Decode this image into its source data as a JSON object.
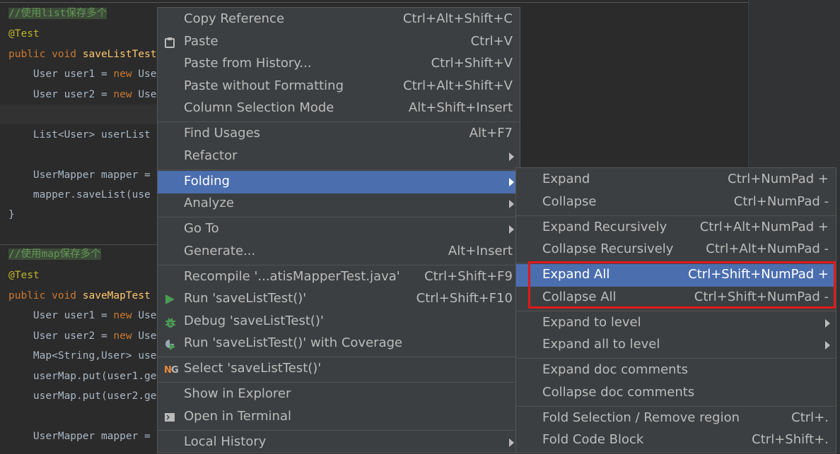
{
  "editor": {
    "lines": [
      {
        "parts": [
          {
            "t": "//使用list保存多个",
            "c": "cmt"
          }
        ]
      },
      {
        "parts": [
          {
            "t": "@Test",
            "c": "ann"
          }
        ]
      },
      {
        "parts": [
          {
            "t": "public void ",
            "c": "kw"
          },
          {
            "t": "saveListTest",
            "c": "fn"
          }
        ]
      },
      {
        "parts": [
          {
            "t": "    User user1 = ",
            "c": ""
          },
          {
            "t": "new ",
            "c": "kw"
          },
          {
            "t": "Use",
            "c": ""
          }
        ]
      },
      {
        "parts": [
          {
            "t": "    User user2 = ",
            "c": ""
          },
          {
            "t": "new ",
            "c": "kw"
          },
          {
            "t": "Use",
            "c": ""
          }
        ]
      },
      {
        "parts": []
      },
      {
        "parts": [
          {
            "t": "    List<User> userList",
            "c": ""
          }
        ]
      },
      {
        "parts": []
      },
      {
        "parts": [
          {
            "t": "    UserMapper mapper =",
            "c": ""
          }
        ]
      },
      {
        "parts": [
          {
            "t": "    mapper.saveList(use",
            "c": ""
          }
        ]
      },
      {
        "parts": [
          {
            "t": "}",
            "c": ""
          }
        ]
      },
      {
        "parts": []
      },
      {
        "parts": [
          {
            "t": "//使用map保存多个",
            "c": "cmt"
          }
        ]
      },
      {
        "parts": [
          {
            "t": "@Test",
            "c": "ann"
          }
        ]
      },
      {
        "parts": [
          {
            "t": "public void ",
            "c": "kw"
          },
          {
            "t": "saveMapTest",
            "c": "fn"
          }
        ]
      },
      {
        "parts": [
          {
            "t": "    User user1 = ",
            "c": ""
          },
          {
            "t": "new ",
            "c": "kw"
          },
          {
            "t": "Use",
            "c": ""
          }
        ]
      },
      {
        "parts": [
          {
            "t": "    User user2 = ",
            "c": ""
          },
          {
            "t": "new ",
            "c": "kw"
          },
          {
            "t": "Use",
            "c": ""
          }
        ]
      },
      {
        "parts": [
          {
            "t": "    Map<String,User> use",
            "c": ""
          }
        ]
      },
      {
        "parts": [
          {
            "t": "    userMap.put(user1.ge",
            "c": ""
          }
        ]
      },
      {
        "parts": [
          {
            "t": "    userMap.put(user2.ge",
            "c": ""
          }
        ]
      },
      {
        "parts": []
      },
      {
        "parts": [
          {
            "t": "    UserMapper mapper =",
            "c": ""
          }
        ]
      }
    ]
  },
  "context_menu": {
    "items": [
      {
        "label": "Copy Reference",
        "shortcut": "Ctrl+Alt+Shift+C"
      },
      {
        "label": "Paste",
        "shortcut": "Ctrl+V",
        "icon": "clipboard-icon"
      },
      {
        "label": "Paste from History...",
        "shortcut": "Ctrl+Shift+V"
      },
      {
        "label": "Paste without Formatting",
        "shortcut": "Ctrl+Alt+Shift+V"
      },
      {
        "label": "Column Selection Mode",
        "shortcut": "Alt+Shift+Insert"
      },
      {
        "label": "Find Usages",
        "shortcut": "Alt+F7"
      },
      {
        "label": "Refactor",
        "submenu": true
      },
      {
        "label": "Folding",
        "submenu": true,
        "selected": true
      },
      {
        "label": "Analyze",
        "submenu": true
      },
      {
        "label": "Go To",
        "submenu": true
      },
      {
        "label": "Generate...",
        "shortcut": "Alt+Insert"
      },
      {
        "label": "Recompile '...atisMapperTest.java'",
        "shortcut": "Ctrl+Shift+F9"
      },
      {
        "label": "Run 'saveListTest()'",
        "shortcut": "Ctrl+Shift+F10",
        "icon": "run-icon"
      },
      {
        "label": "Debug 'saveListTest()'",
        "icon": "debug-icon"
      },
      {
        "label": "Run 'saveListTest()' with Coverage",
        "icon": "coverage-icon"
      },
      {
        "label": "Select 'saveListTest()'",
        "icon": "testng-icon"
      },
      {
        "label": "Show in Explorer"
      },
      {
        "label": "Open in Terminal",
        "icon": "terminal-icon"
      },
      {
        "label": "Local History",
        "submenu": true
      }
    ]
  },
  "folding_submenu": {
    "items": [
      {
        "label": "Expand",
        "shortcut": "Ctrl+NumPad +"
      },
      {
        "label": "Collapse",
        "shortcut": "Ctrl+NumPad -"
      },
      {
        "label": "Expand Recursively",
        "shortcut": "Ctrl+Alt+NumPad +"
      },
      {
        "label": "Collapse Recursively",
        "shortcut": "Ctrl+Alt+NumPad -"
      },
      {
        "label": "Expand All",
        "shortcut": "Ctrl+Shift+NumPad +",
        "selected": true
      },
      {
        "label": "Collapse All",
        "shortcut": "Ctrl+Shift+NumPad -"
      },
      {
        "label": "Expand to level",
        "submenu": true
      },
      {
        "label": "Expand all to level",
        "submenu": true
      },
      {
        "label": "Expand doc comments"
      },
      {
        "label": "Collapse doc comments"
      },
      {
        "label": "Fold Selection / Remove region",
        "shortcut": "Ctrl+."
      },
      {
        "label": "Fold Code Block",
        "shortcut": "Ctrl+Shift+."
      }
    ]
  },
  "colors": {
    "highlight_box": "#e0191b",
    "selection": "#4b6eaf"
  }
}
